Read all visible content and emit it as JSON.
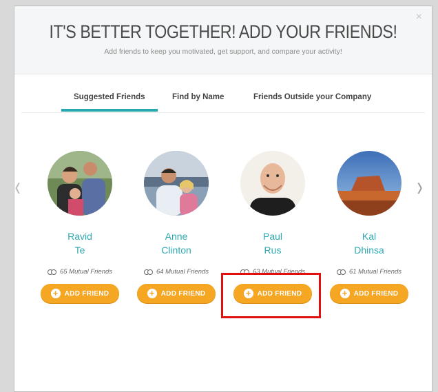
{
  "modal": {
    "close_label": "×",
    "title": "IT'S BETTER TOGETHER! ADD YOUR FRIENDS!",
    "subtitle": "Add friends to keep you motivated, get support, and compare your activity!"
  },
  "tabs": [
    {
      "label": "Suggested Friends",
      "active": true
    },
    {
      "label": "Find by Name",
      "active": false
    },
    {
      "label": "Friends Outside your Company",
      "active": false
    }
  ],
  "nav": {
    "prev": "‹",
    "next": "›"
  },
  "friends": [
    {
      "first": "Ravid",
      "last": "Te",
      "mutual": "65 Mutual Friends",
      "button": "ADD FRIEND"
    },
    {
      "first": "Anne",
      "last": "Clinton",
      "mutual": "64 Mutual Friends",
      "button": "ADD FRIEND"
    },
    {
      "first": "Paul",
      "last": "Rus",
      "mutual": "63 Mutual Friends",
      "button": "ADD FRIEND"
    },
    {
      "first": "Kal",
      "last": "Dhinsa",
      "mutual": "61 Mutual Friends",
      "button": "ADD FRIEND"
    }
  ],
  "colors": {
    "accent": "#26a8b1",
    "button": "#f5a623",
    "highlight": "#e01010"
  }
}
